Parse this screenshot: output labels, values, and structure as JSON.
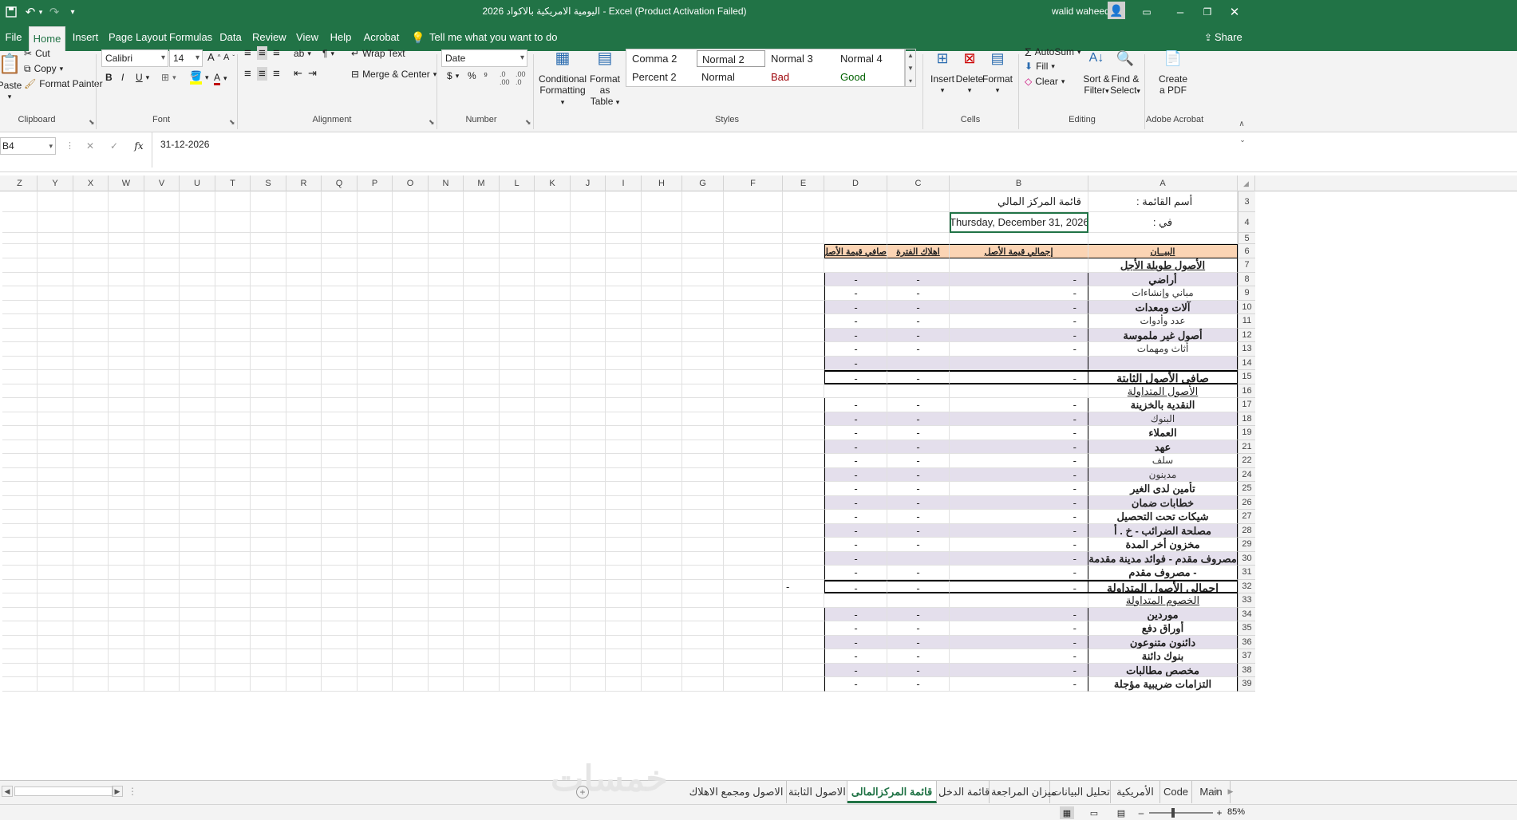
{
  "window": {
    "title": "اليومية الامريكية بالاكواد 2026  -  Excel (Product Activation Failed)",
    "user": "walid waheed"
  },
  "ribbon_tabs": [
    {
      "label": "File"
    },
    {
      "label": "Home"
    },
    {
      "label": "Insert"
    },
    {
      "label": "Page Layout"
    },
    {
      "label": "Formulas"
    },
    {
      "label": "Data"
    },
    {
      "label": "Review"
    },
    {
      "label": "View"
    },
    {
      "label": "Help"
    },
    {
      "label": "Acrobat"
    }
  ],
  "tell_me": "Tell me what you want to do",
  "share": "Share",
  "clipboard": {
    "paste": "Paste",
    "cut": "Cut",
    "copy": "Copy",
    "format_painter": "Format Painter",
    "label": "Clipboard"
  },
  "font": {
    "name": "Calibri",
    "size": "14",
    "bold": "B",
    "italic": "I",
    "underline": "U",
    "label": "Font"
  },
  "alignment": {
    "wrap_text": "Wrap Text",
    "merge_center": "Merge & Center",
    "label": "Alignment"
  },
  "number": {
    "format": "Date",
    "label": "Number"
  },
  "styles": {
    "conditional": [
      "Conditional",
      "Formatting"
    ],
    "format_as_table": [
      "Format as",
      "Table"
    ],
    "cells": [
      {
        "label": "Comma 2",
        "bg": "#ffffff"
      },
      {
        "label": "Normal 2",
        "bg": "#ffffff"
      },
      {
        "label": "Normal 3",
        "bg": "#ffffff"
      },
      {
        "label": "Normal 4",
        "bg": "#ffffff"
      },
      {
        "label": "Percent 2",
        "bg": "#ffffff"
      },
      {
        "label": "Normal",
        "bg": "#ffffff"
      },
      {
        "label": "Bad",
        "bg": "#ffc7ce"
      },
      {
        "label": "Good",
        "bg": "#c6efce"
      }
    ],
    "label": "Styles"
  },
  "cells_grp": {
    "insert": "Insert",
    "delete": "Delete",
    "format": "Format",
    "label": "Cells"
  },
  "editing": {
    "autosum": "AutoSum",
    "fill": "Fill",
    "clear": "Clear",
    "sort": [
      "Sort &",
      "Filter"
    ],
    "find": [
      "Find &",
      "Select"
    ],
    "label": "Editing"
  },
  "acrobat": {
    "create": [
      "Create",
      "a PDF"
    ],
    "label": "Adobe Acrobat"
  },
  "formula_bar": {
    "name_box": "B4",
    "formula": "31-12-2026",
    "fx": "fx"
  },
  "columns": [
    "Z",
    "Y",
    "X",
    "W",
    "V",
    "U",
    "T",
    "S",
    "R",
    "Q",
    "P",
    "O",
    "N",
    "M",
    "L",
    "K",
    "J",
    "I",
    "H",
    "G",
    "F",
    "E",
    "D",
    "C",
    "B",
    "A"
  ],
  "sheet": {
    "A3": "أسم القائمة :",
    "B3": "قائمة المركز المالي",
    "A4": "في   :",
    "B4": "Thursday, December 31, 2026",
    "headers": {
      "A": "البيــان",
      "B": "إجمالي قيمة الأصل",
      "C": "اهلاك الفترة",
      "D": "صافي قيمة الأصل"
    },
    "rows": [
      {
        "n": "7",
        "a": "الأصول طويلة الأجل",
        "b": "",
        "c": "",
        "d": "",
        "style": "title"
      },
      {
        "n": "8",
        "a": "أراضي",
        "b": "-",
        "c": "-",
        "d": "-",
        "style": "bold"
      },
      {
        "n": "9",
        "a": "مباني وإنشاءات",
        "b": "-",
        "c": "-",
        "d": "-",
        "style": "normal"
      },
      {
        "n": "10",
        "a": "آلات ومعدات",
        "b": "-",
        "c": "-",
        "d": "-",
        "style": "bold"
      },
      {
        "n": "11",
        "a": "عدد وأدوات",
        "b": "-",
        "c": "-",
        "d": "-",
        "style": "normal"
      },
      {
        "n": "12",
        "a": "أصول غير ملموسة",
        "b": "-",
        "c": "-",
        "d": "-",
        "style": "bold"
      },
      {
        "n": "13",
        "a": "أثاث ومهمات",
        "b": "-",
        "c": "-",
        "d": "-",
        "style": "normal"
      },
      {
        "n": "14",
        "a": "",
        "b": "",
        "c": "",
        "d": "-",
        "style": "normal"
      },
      {
        "n": "15",
        "a": "صافي الأصول الثابتة",
        "b": "-",
        "c": "-",
        "d": "-",
        "style": "total"
      },
      {
        "n": "16",
        "a": "الأصول المتداولة",
        "b": "",
        "c": "",
        "d": "",
        "style": "section"
      },
      {
        "n": "17",
        "a": "النقدية بالخزينة",
        "b": "-",
        "c": "-",
        "d": "-",
        "style": "bold"
      },
      {
        "n": "18",
        "a": "البنوك",
        "b": "-",
        "c": "-",
        "d": "-",
        "style": "normal"
      },
      {
        "n": "19",
        "a": "العملاء",
        "b": "-",
        "c": "-",
        "d": "-",
        "style": "bold"
      },
      {
        "n": "21",
        "a": "عهد",
        "b": "-",
        "c": "-",
        "d": "-",
        "style": "bold"
      },
      {
        "n": "22",
        "a": "سلف",
        "b": "-",
        "c": "-",
        "d": "-",
        "style": "normal"
      },
      {
        "n": "24",
        "a": "مدينون",
        "b": "-",
        "c": "-",
        "d": "-",
        "style": "normal"
      },
      {
        "n": "25",
        "a": "تأمين لدى الغير",
        "b": "-",
        "c": "-",
        "d": "-",
        "style": "bold"
      },
      {
        "n": "26",
        "a": "خطابات ضمان",
        "b": "-",
        "c": "-",
        "d": "-",
        "style": "bold"
      },
      {
        "n": "27",
        "a": "شيكات تحت التحصيل",
        "b": "-",
        "c": "-",
        "d": "-",
        "style": "bold"
      },
      {
        "n": "28",
        "a": "مصلحة الضرائب - خ . أ",
        "b": "-",
        "c": "-",
        "d": "-",
        "style": "bold"
      },
      {
        "n": "29",
        "a": "مخزون أخر المدة",
        "b": "-",
        "c": "-",
        "d": "-",
        "style": "bold"
      },
      {
        "n": "30",
        "a": "مصروف مقدم - فوائد مدينة مقدمة",
        "b": "-",
        "c": "",
        "d": "-",
        "style": "bold"
      },
      {
        "n": "31",
        "a": "- مصروف مقدم",
        "b": "-",
        "c": "-",
        "d": "-",
        "style": "bold"
      },
      {
        "n": "32",
        "a": "إجمالي الأصول المتداولة",
        "b": "-",
        "c": "-",
        "d": "-",
        "style": "total",
        "e": "-"
      },
      {
        "n": "33",
        "a": "الخصوم المتداولة",
        "b": "",
        "c": "",
        "d": "",
        "style": "section"
      },
      {
        "n": "34",
        "a": "موردين",
        "b": "-",
        "c": "-",
        "d": "-",
        "style": "bold"
      },
      {
        "n": "35",
        "a": "أوراق دفع",
        "b": "-",
        "c": "-",
        "d": "-",
        "style": "bold"
      },
      {
        "n": "36",
        "a": "دائنون متنوعون",
        "b": "-",
        "c": "-",
        "d": "-",
        "style": "bold"
      },
      {
        "n": "37",
        "a": "بنوك دائنة",
        "b": "-",
        "c": "-",
        "d": "-",
        "style": "bold"
      },
      {
        "n": "38",
        "a": "مخصص مطالبات",
        "b": "-",
        "c": "-",
        "d": "-",
        "style": "bold"
      },
      {
        "n": "39",
        "a": "التزامات ضريبية مؤجلة",
        "b": "-",
        "c": "-",
        "d": "-",
        "style": "bold"
      }
    ]
  },
  "sheet_tabs": [
    {
      "label": "Main"
    },
    {
      "label": "Code"
    },
    {
      "label": "الأمريكية"
    },
    {
      "label": "تحليل البيانات"
    },
    {
      "label": "ميزان المراجعة"
    },
    {
      "label": "قائمة الدخل"
    },
    {
      "label": "قائمة المركزالمالى"
    },
    {
      "label": "الاصول الثابتة"
    },
    {
      "label": "الاصول ومجمع الاهلاك"
    }
  ],
  "zoom": "85%",
  "watermark": "خمسات",
  "colors": {
    "accent": "#217346",
    "header_fill": "#fbd4b4",
    "band": "#e4dfec"
  }
}
